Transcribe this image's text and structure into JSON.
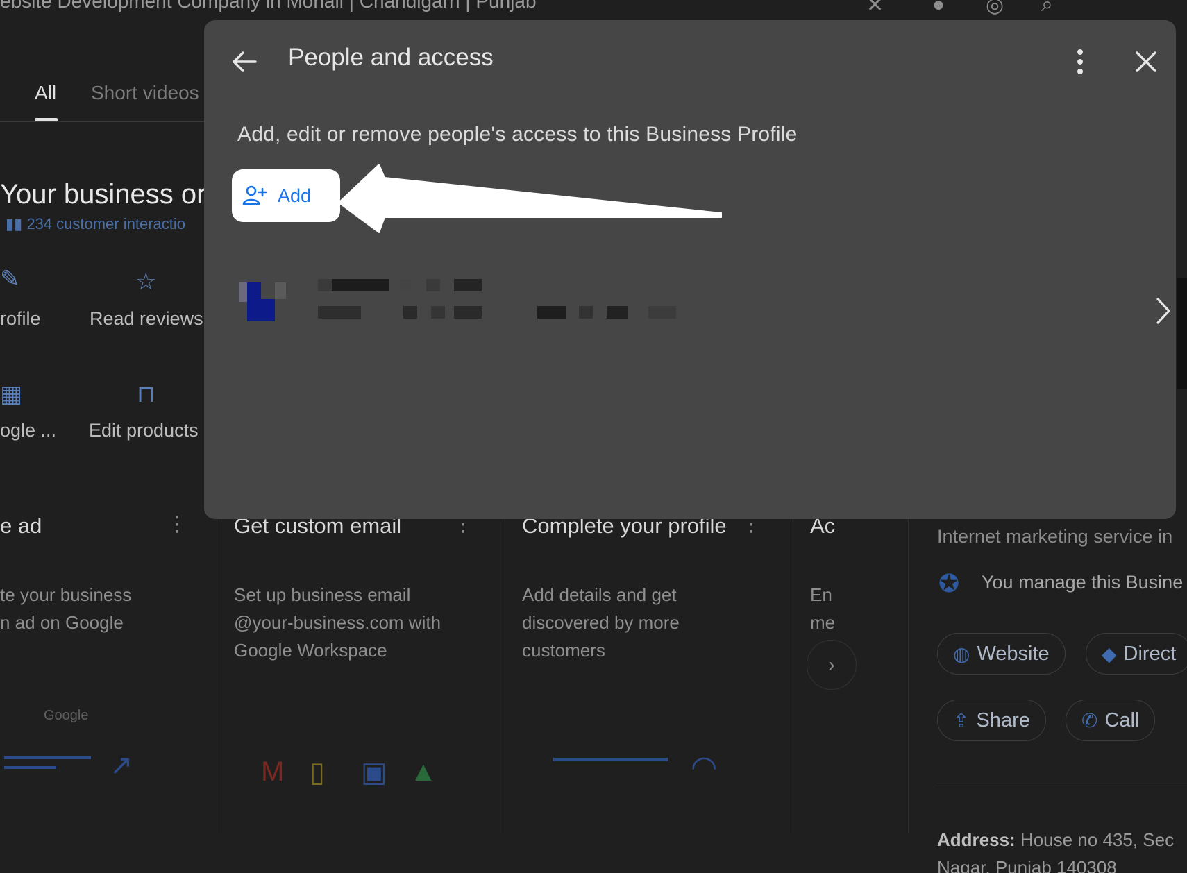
{
  "background": {
    "window_title": "ebsite Development Company in Mohali | Chandigarh | Punjab",
    "tabs": [
      {
        "label": "All",
        "active": true
      },
      {
        "label": "Short videos",
        "active": false
      }
    ],
    "business_heading": "Your business or",
    "interactions_text": "234 customer interactio",
    "actions": [
      {
        "label": "rofile",
        "icon": "pencil-icon"
      },
      {
        "label": "Read reviews",
        "icon": "review-star-icon"
      },
      {
        "label": "ogle ...",
        "icon": "qr-icon"
      },
      {
        "label": "Edit products",
        "icon": "shopping-bag-icon"
      }
    ],
    "cards": [
      {
        "title": "e ad",
        "text": [
          "te your business",
          "n ad on Google"
        ],
        "illustration": "Google"
      },
      {
        "title": "Get custom email",
        "text": [
          "Set up business email",
          "@your-business.com with",
          "Google Workspace"
        ]
      },
      {
        "title": "Complete your profile",
        "text": [
          "Add details and get",
          "discovered by more",
          "customers"
        ]
      },
      {
        "title": "Ac",
        "text": [
          "En",
          "me"
        ]
      }
    ],
    "knowledge_panel": {
      "category": "Internet marketing service in",
      "managed_text": "You manage this Busine",
      "buttons": [
        {
          "label": "Website",
          "icon": "globe-icon"
        },
        {
          "label": "Direct",
          "icon": "directions-icon"
        },
        {
          "label": "Share",
          "icon": "share-icon"
        },
        {
          "label": "Call",
          "icon": "phone-icon"
        }
      ],
      "address_label": "Address:",
      "address_line1": " House no 435, Sec",
      "address_line2": "Nagar, Punjab 140308"
    }
  },
  "dialog": {
    "title": "People and access",
    "description": "Add, edit or remove people's access to this Business Profile",
    "add_button_label": "Add",
    "add_icon": "person-add-icon",
    "back_icon": "arrow-back-icon",
    "more_icon": "more-vert-icon",
    "close_icon": "close-icon",
    "person_row": {
      "name": "",
      "email": "",
      "blurred": true,
      "chevron_icon": "chevron-right-icon"
    },
    "colors": {
      "dialog_bg": "#464646",
      "accent": "#1a73e8",
      "overlay": "#1f1f1f"
    }
  }
}
